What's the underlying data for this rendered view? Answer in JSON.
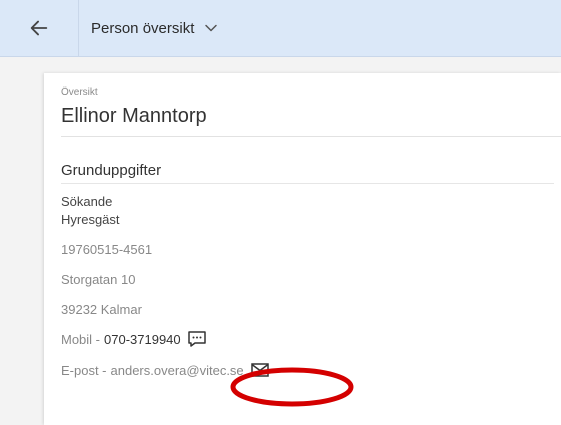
{
  "header": {
    "title": "Person översikt"
  },
  "card": {
    "kicker": "Översikt",
    "name": "Ellinor Manntorp",
    "section_title": "Grunduppgifter",
    "roles": [
      "Sökande",
      "Hyresgäst"
    ],
    "personal_number": "19760515-4561",
    "street": "Storgatan 10",
    "postal_city": "39232 Kalmar",
    "mobile_label": "Mobil -",
    "mobile_number": "070-3719940",
    "email_label": "E-post -",
    "email_address": "anders.overa@vitec.se"
  },
  "colors": {
    "header_bg": "#dbe8f8",
    "annotation": "#d40000"
  },
  "icons": [
    "arrow-left-icon",
    "chevron-down-icon",
    "message-icon",
    "envelope-icon"
  ]
}
